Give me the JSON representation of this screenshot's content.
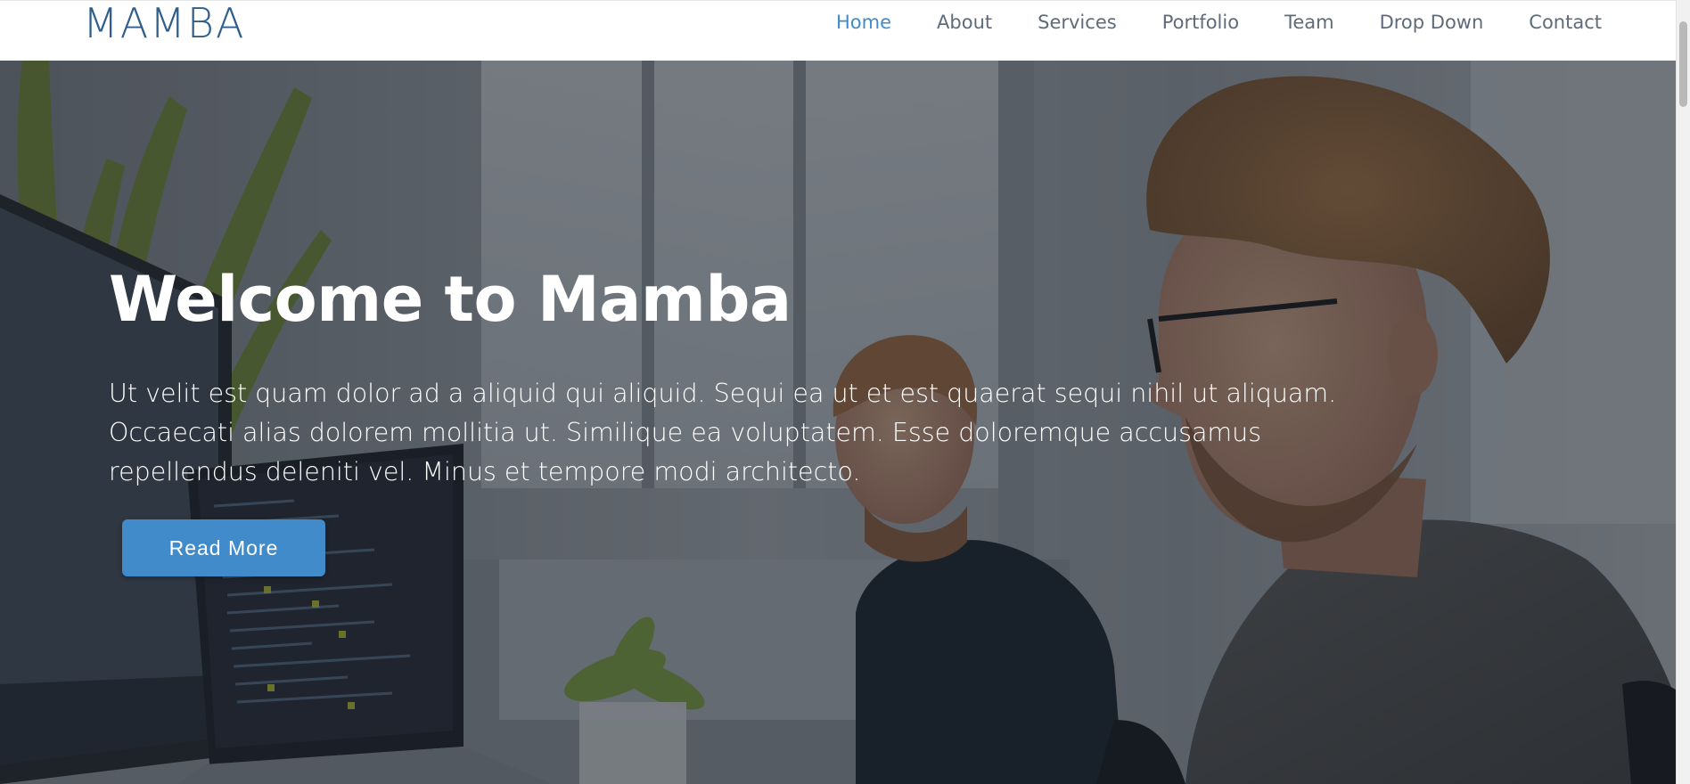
{
  "header": {
    "logo": "MAMBA",
    "nav": [
      {
        "label": "Home",
        "active": true
      },
      {
        "label": "About"
      },
      {
        "label": "Services"
      },
      {
        "label": "Portfolio"
      },
      {
        "label": "Team"
      },
      {
        "label": "Drop Down"
      },
      {
        "label": "Contact"
      }
    ]
  },
  "hero": {
    "title": "Welcome to Mamba",
    "text": "Ut velit est quam dolor ad a aliquid qui aliquid. Sequi ea ut et est quaerat sequi nihil ut aliquam. Occaecati alias dolorem mollitia ut. Similique ea voluptatem. Esse doloremque accusamus repellendus deleniti vel. Minus et tempore modi architecto.",
    "button_label": "Read More"
  },
  "colors": {
    "accent": "#428bca",
    "logo": "#2f5e8c",
    "nav_text": "#5f6b79",
    "hero_text": "#ffffff"
  }
}
